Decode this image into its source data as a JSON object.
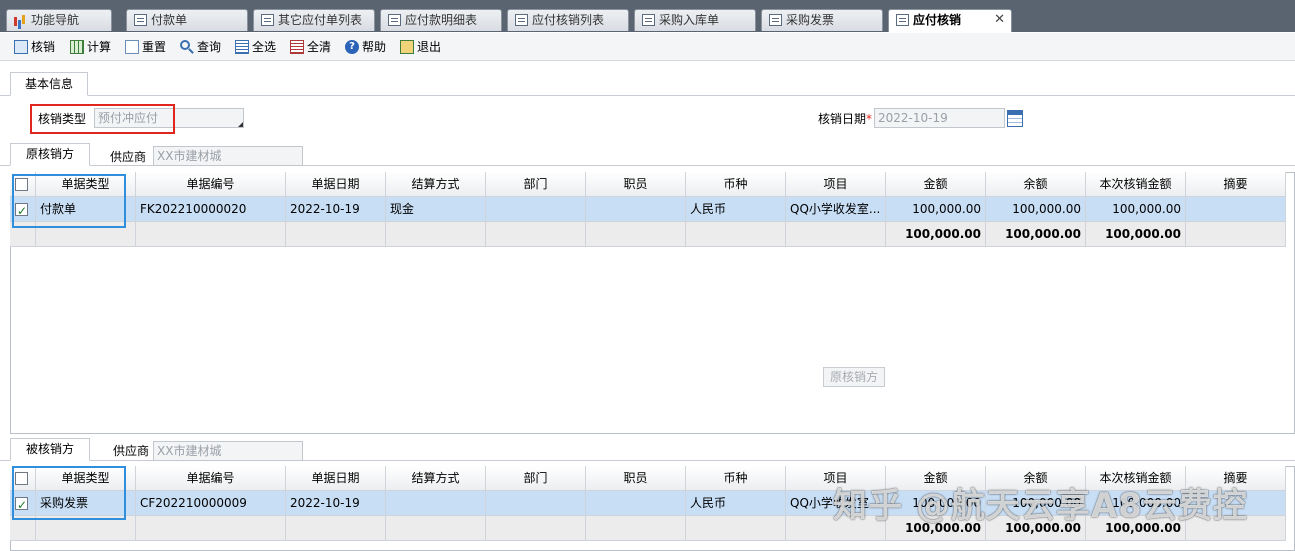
{
  "tabs": [
    {
      "label": "功能导航",
      "icon": "chart-icon"
    },
    {
      "label": "付款单",
      "icon": "form-icon"
    },
    {
      "label": "其它应付单列表",
      "icon": "form-icon"
    },
    {
      "label": "应付款明细表",
      "icon": "form-icon"
    },
    {
      "label": "应付核销列表",
      "icon": "form-icon"
    },
    {
      "label": "采购入库单",
      "icon": "form-icon"
    },
    {
      "label": "采购发票",
      "icon": "form-icon"
    },
    {
      "label": "应付核销",
      "icon": "form-icon",
      "active": true,
      "close": "✕"
    }
  ],
  "toolbar": {
    "writeoff": "核销",
    "calculate": "计算",
    "reset": "重置",
    "query": "查询",
    "select_all": "全选",
    "clear_all": "全清",
    "help": "帮助",
    "exit": "退出"
  },
  "info": {
    "tab_label": "基本信息",
    "type_label": "核销类型",
    "type_value": "预付冲应付",
    "date_label": "核销日期",
    "date_required": "*",
    "date_value": "2022-10-19"
  },
  "source": {
    "tab_label": "原核销方",
    "supplier_label": "供应商",
    "supplier_value": "XX市建材城",
    "columns": [
      "单据类型",
      "单据编号",
      "单据日期",
      "结算方式",
      "部门",
      "职员",
      "币种",
      "项目",
      "金额",
      "余额",
      "本次核销金额",
      "摘要"
    ],
    "rows": [
      {
        "type": "付款单",
        "number": "FK202210000020",
        "date": "2022-10-19",
        "settle": "现金",
        "dept": "",
        "staff": "",
        "currency": "人民币",
        "project": "QQ小学收发室...",
        "amount": "100,000.00",
        "balance": "100,000.00",
        "writeoff": "100,000.00",
        "memo": "",
        "checked": true
      }
    ],
    "totals": {
      "amount": "100,000.00",
      "balance": "100,000.00",
      "writeoff": "100,000.00"
    },
    "empty_label": "原核销方"
  },
  "target": {
    "tab_label": "被核销方",
    "supplier_label": "供应商",
    "supplier_value": "XX市建材城",
    "columns": [
      "单据类型",
      "单据编号",
      "单据日期",
      "结算方式",
      "部门",
      "职员",
      "币种",
      "项目",
      "金额",
      "余额",
      "本次核销金额",
      "摘要"
    ],
    "rows": [
      {
        "type": "采购发票",
        "number": "CF202210000009",
        "date": "2022-10-19",
        "settle": "",
        "dept": "",
        "staff": "",
        "currency": "人民币",
        "project": "QQ小学收发室...",
        "amount": "100,000.00",
        "balance": "100,000.00",
        "writeoff": "100,000.00",
        "memo": "",
        "checked": true
      }
    ],
    "totals": {
      "amount": "100,000.00",
      "balance": "100,000.00",
      "writeoff": "100,000.00"
    }
  },
  "watermark": "知乎 @航天云享A8云费控",
  "colors": {
    "highlight_red": "#e0261e",
    "highlight_blue": "#2f8fdc",
    "selected_row": "#c8def5"
  }
}
